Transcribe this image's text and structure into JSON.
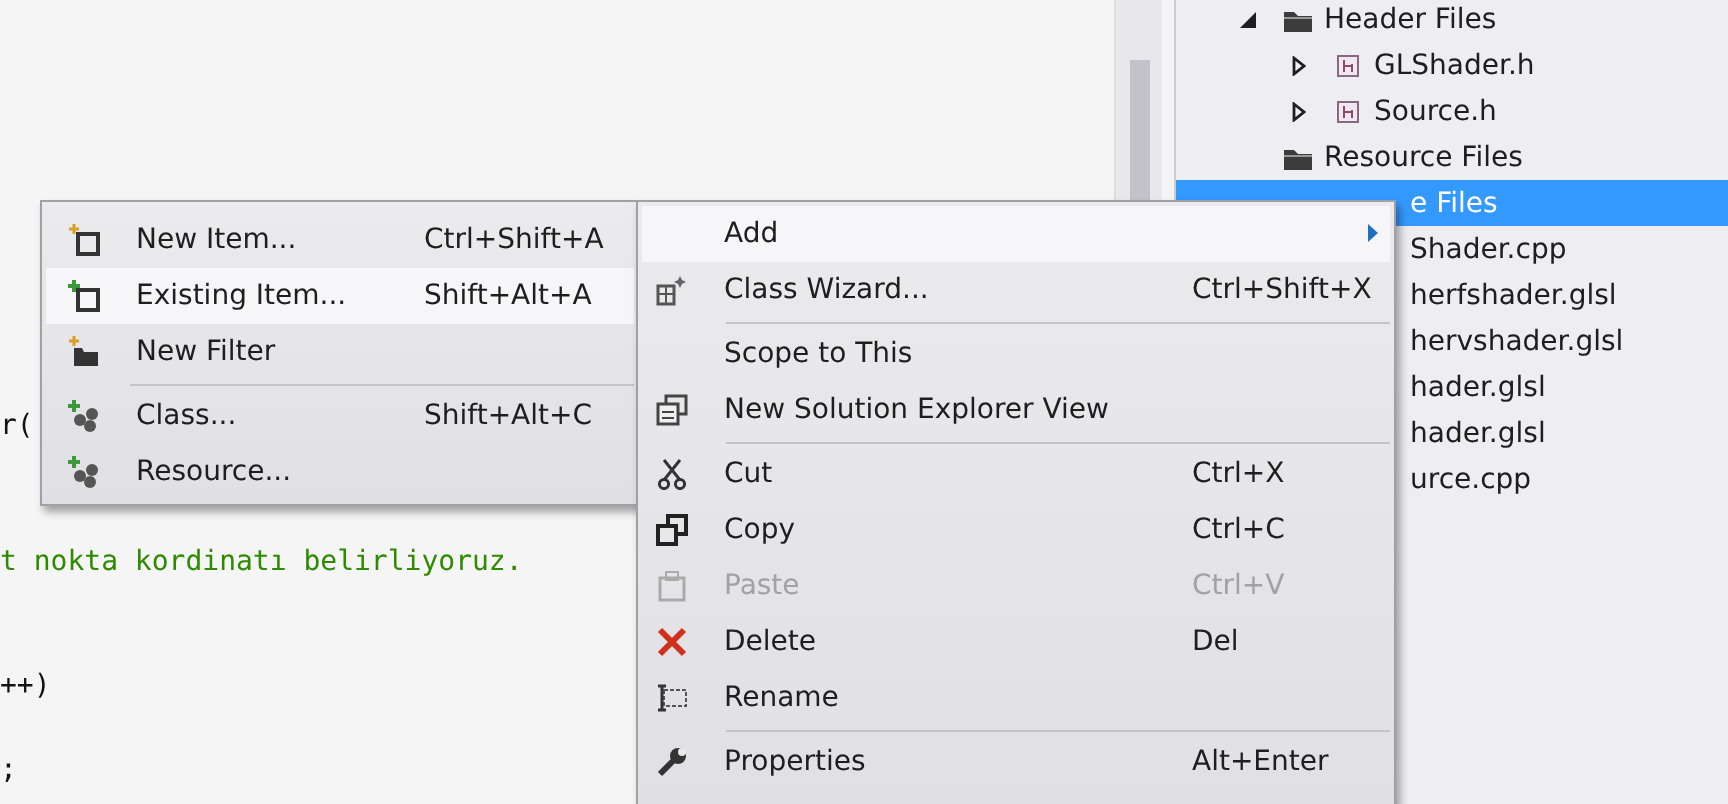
{
  "editor": {
    "lines": [
      {
        "text": "r(",
        "kind": "code"
      },
      {
        "text": "t nokta kordinatı belirliyoruz.",
        "kind": "comment"
      },
      {
        "text": "++)",
        "kind": "code"
      },
      {
        "text": ";",
        "kind": "code"
      }
    ]
  },
  "solution_explorer": {
    "items": [
      {
        "label": "Header Files",
        "kind": "folder",
        "expanded": true,
        "selected": false,
        "children": [
          {
            "label": "GLShader.h",
            "kind": "file",
            "expanded": false,
            "selected": false
          },
          {
            "label": "Source.h",
            "kind": "file",
            "expanded": false,
            "selected": false
          }
        ]
      },
      {
        "label": "Resource Files",
        "kind": "folder",
        "selected": false
      },
      {
        "label": "e Files",
        "kind": "covered",
        "selected": true,
        "children": [
          {
            "label": "Shader.cpp",
            "kind": "covered",
            "selected": false
          },
          {
            "label": "herfshader.glsl",
            "kind": "covered",
            "selected": false
          },
          {
            "label": "hervshader.glsl",
            "kind": "covered",
            "selected": false
          },
          {
            "label": "hader.glsl",
            "kind": "covered",
            "selected": false
          },
          {
            "label": "hader.glsl",
            "kind": "covered",
            "selected": false
          },
          {
            "label": "urce.cpp",
            "kind": "covered",
            "selected": false
          }
        ]
      }
    ]
  },
  "add_submenu": {
    "items": [
      {
        "kind": "item",
        "label": "New Item...",
        "shortcut": "Ctrl+Shift+A",
        "selected": false,
        "disabled": false
      },
      {
        "kind": "item",
        "label": "Existing Item...",
        "shortcut": "Shift+Alt+A",
        "selected": true,
        "disabled": false
      },
      {
        "kind": "item",
        "label": "New Filter",
        "selected": false,
        "disabled": false
      },
      {
        "kind": "separator"
      },
      {
        "kind": "item",
        "label": "Class...",
        "shortcut": "Shift+Alt+C",
        "selected": false,
        "disabled": false
      },
      {
        "kind": "item",
        "label": "Resource...",
        "selected": false,
        "disabled": false
      }
    ]
  },
  "context_menu": {
    "items": [
      {
        "kind": "item",
        "label": "Add",
        "has_submenu": true,
        "selected": true,
        "disabled": false
      },
      {
        "kind": "item",
        "label": "Class Wizard...",
        "shortcut": "Ctrl+Shift+X",
        "selected": false,
        "disabled": false
      },
      {
        "kind": "separator"
      },
      {
        "kind": "item",
        "label": "Scope to This",
        "selected": false,
        "disabled": false
      },
      {
        "kind": "item",
        "label": "New Solution Explorer View",
        "selected": false,
        "disabled": false
      },
      {
        "kind": "separator"
      },
      {
        "kind": "item",
        "label": "Cut",
        "shortcut": "Ctrl+X",
        "selected": false,
        "disabled": false
      },
      {
        "kind": "item",
        "label": "Copy",
        "shortcut": "Ctrl+C",
        "selected": false,
        "disabled": false
      },
      {
        "kind": "item",
        "label": "Paste",
        "shortcut": "Ctrl+V",
        "selected": false,
        "disabled": true
      },
      {
        "kind": "item",
        "label": "Delete",
        "shortcut": "Del",
        "selected": false,
        "disabled": false
      },
      {
        "kind": "item",
        "label": "Rename",
        "selected": false,
        "disabled": false
      },
      {
        "kind": "separator"
      },
      {
        "kind": "item",
        "label": "Properties",
        "shortcut": "Alt+Enter",
        "selected": false,
        "disabled": false
      }
    ]
  }
}
